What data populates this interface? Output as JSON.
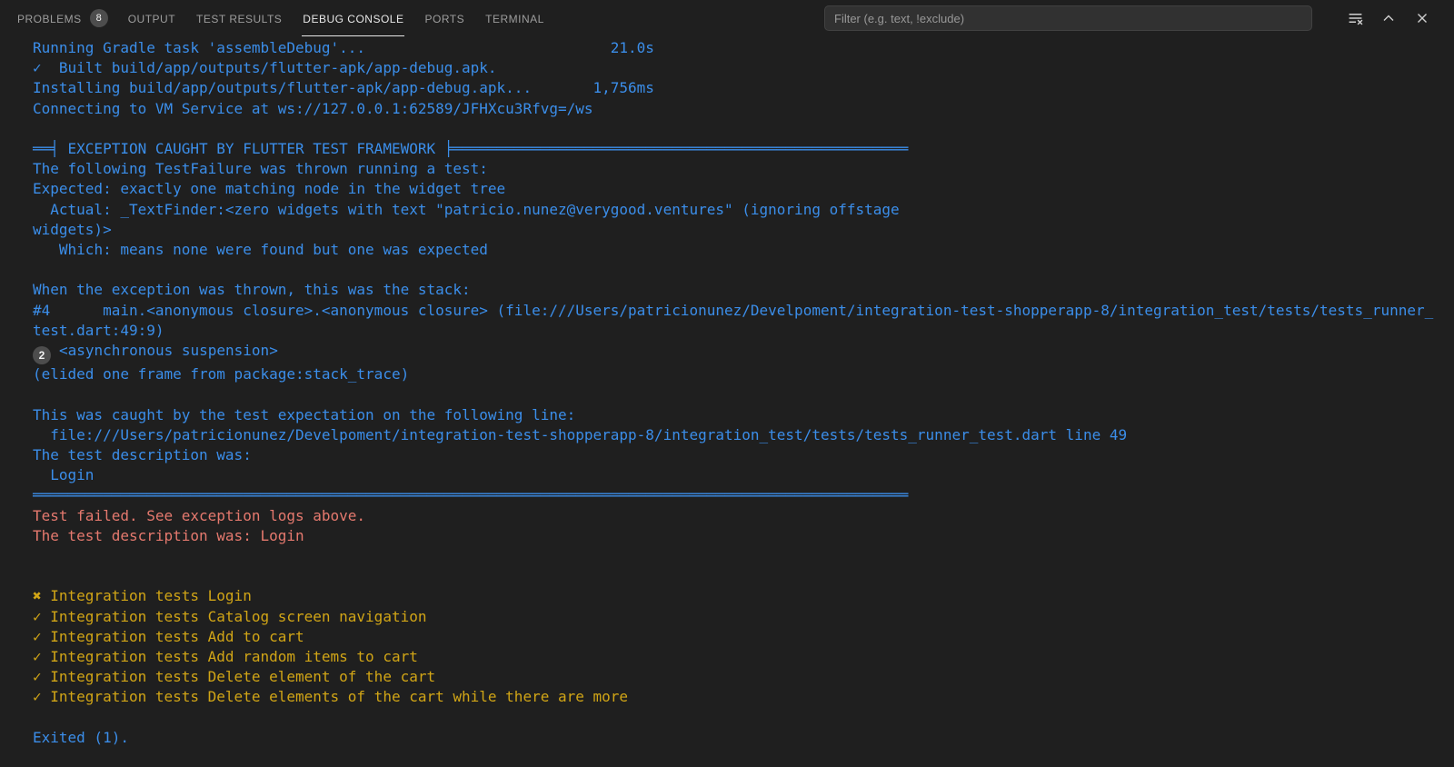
{
  "colors": {
    "panel_bg": "#1f1f1f",
    "info": "#3b8eea",
    "error": "#e5796e",
    "warn": "#d1a516",
    "badge_bg": "#4d4d4d",
    "badge_fg": "#f2f2f2",
    "tab_fg": "#9d9d9d",
    "tab_active_fg": "#e7e7e7",
    "input_bg": "#313131",
    "placeholder_fg": "#989898",
    "icon_fg": "#cfcfcf"
  },
  "panel": {
    "tabs": [
      {
        "label": "PROBLEMS",
        "badge": "8",
        "active": false
      },
      {
        "label": "OUTPUT",
        "active": false
      },
      {
        "label": "TEST RESULTS",
        "active": false
      },
      {
        "label": "DEBUG CONSOLE",
        "active": true
      },
      {
        "label": "PORTS",
        "active": false
      },
      {
        "label": "TERMINAL",
        "active": false
      }
    ],
    "filter": {
      "placeholder": "Filter (e.g. text, !exclude)"
    },
    "actions": [
      {
        "name": "clear-console"
      },
      {
        "name": "maximize-panel"
      },
      {
        "name": "close-panel"
      }
    ]
  },
  "console": {
    "lines": [
      {
        "cls": "info",
        "text": "Running Gradle task 'assembleDebug'...                            21.0s"
      },
      {
        "cls": "info",
        "text": "✓  Built build/app/outputs/flutter-apk/app-debug.apk."
      },
      {
        "cls": "info",
        "text": "Installing build/app/outputs/flutter-apk/app-debug.apk...       1,756ms"
      },
      {
        "cls": "info",
        "text": "Connecting to VM Service at ws://127.0.0.1:62589/JFHXcu3Rfvg=/ws"
      },
      {
        "cls": "blank",
        "text": ""
      },
      {
        "cls": "info",
        "text": "══╡ EXCEPTION CAUGHT BY FLUTTER TEST FRAMEWORK ╞════════════════════════════════════════════════════"
      },
      {
        "cls": "info",
        "text": "The following TestFailure was thrown running a test:"
      },
      {
        "cls": "info",
        "text": "Expected: exactly one matching node in the widget tree"
      },
      {
        "cls": "info",
        "text": "  Actual: _TextFinder:<zero widgets with text \"patricio.nunez@verygood.ventures\" (ignoring offstage"
      },
      {
        "cls": "info",
        "text": "widgets)>"
      },
      {
        "cls": "info",
        "text": "   Which: means none were found but one was expected"
      },
      {
        "cls": "blank",
        "text": ""
      },
      {
        "cls": "info",
        "text": "When the exception was thrown, this was the stack:"
      },
      {
        "cls": "info",
        "text": "#4      main.<anonymous closure>.<anonymous closure> (file:///Users/patricionunez/Develpoment/integration-test-shopperapp-8/integration_test/tests/tests_runner_test.dart:49:9)"
      },
      {
        "cls": "info",
        "badge": "2",
        "text": "<asynchronous suspension>"
      },
      {
        "cls": "info",
        "text": "(elided one frame from package:stack_trace)"
      },
      {
        "cls": "blank",
        "text": ""
      },
      {
        "cls": "info",
        "text": "This was caught by the test expectation on the following line:"
      },
      {
        "cls": "info",
        "text": "  file:///Users/patricionunez/Develpoment/integration-test-shopperapp-8/integration_test/tests/tests_runner_test.dart line 49"
      },
      {
        "cls": "info",
        "text": "The test description was:"
      },
      {
        "cls": "info",
        "text": "  Login"
      },
      {
        "cls": "info",
        "text": "════════════════════════════════════════════════════════════════════════════════════════════════════"
      },
      {
        "cls": "error",
        "text": "Test failed. See exception logs above."
      },
      {
        "cls": "error",
        "text": "The test description was: Login"
      },
      {
        "cls": "blank",
        "text": ""
      },
      {
        "cls": "blank",
        "text": ""
      },
      {
        "cls": "warn",
        "text": "✖ Integration tests Login"
      },
      {
        "cls": "warn",
        "text": "✓ Integration tests Catalog screen navigation"
      },
      {
        "cls": "warn",
        "text": "✓ Integration tests Add to cart"
      },
      {
        "cls": "warn",
        "text": "✓ Integration tests Add random items to cart"
      },
      {
        "cls": "warn",
        "text": "✓ Integration tests Delete element of the cart"
      },
      {
        "cls": "warn",
        "text": "✓ Integration tests Delete elements of the cart while there are more"
      },
      {
        "cls": "blank",
        "text": ""
      },
      {
        "cls": "info",
        "text": "Exited (1)."
      }
    ]
  }
}
